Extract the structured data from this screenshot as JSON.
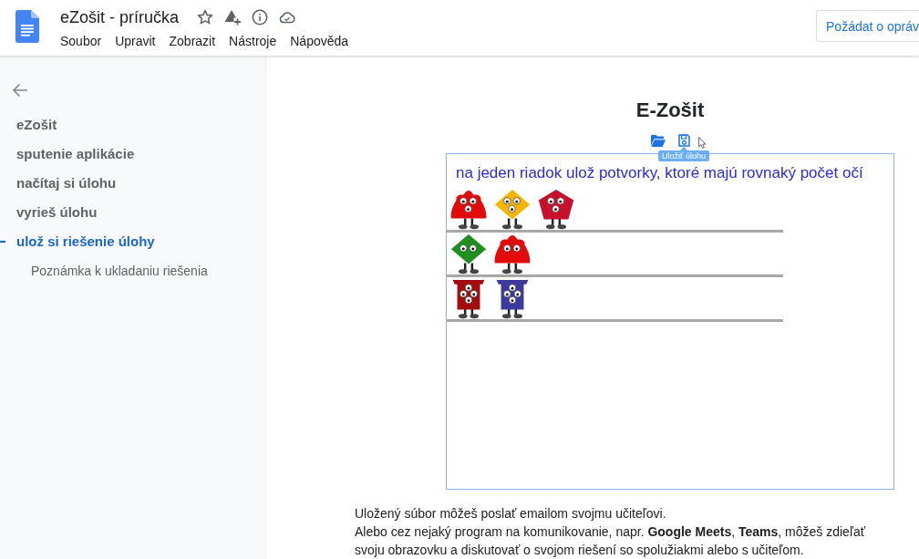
{
  "header": {
    "title": "eZošit - príručka",
    "menu": [
      "Soubor",
      "Upravit",
      "Zobrazit",
      "Nástroje",
      "Nápověda"
    ],
    "button": "Požádat o opráv"
  },
  "sidebar": {
    "items": [
      {
        "label": "eZošit",
        "selected": false
      },
      {
        "label": "sputenie aplikácie",
        "selected": false
      },
      {
        "label": "načítaj si úlohu",
        "selected": false
      },
      {
        "label": "vyrieš úlohu",
        "selected": false
      },
      {
        "label": "ulož si riešenie úlohy",
        "selected": true,
        "children": [
          {
            "label": "Poznámka k ukladaniu riešenia",
            "selected": false
          }
        ]
      }
    ]
  },
  "page": {
    "heading": "E-Zošit",
    "tooltip": "Uložiť úlohu",
    "task": {
      "instruction": "na jeden riadok ulož potvorky, ktoré majú rovnaký počet očí",
      "rows": [
        {
          "monsters": [
            {
              "kind": "blob3",
              "color": "#e20a0a"
            },
            {
              "kind": "diamond3",
              "color": "#f7b500"
            },
            {
              "kind": "pentagon3",
              "color": "#c8102e"
            }
          ]
        },
        {
          "monsters": [
            {
              "kind": "diamond2",
              "color": "#1f8f1f"
            },
            {
              "kind": "blob2",
              "color": "#e20a0a"
            }
          ]
        },
        {
          "monsters": [
            {
              "kind": "banner4",
              "color": "#a30d0d"
            },
            {
              "kind": "banner4",
              "color": "#3d3a9e"
            }
          ]
        }
      ]
    },
    "paragraphs": [
      "Uložený súbor môžeš poslať emailom svojmu učiteľovi.",
      "Alebo cez nejaký program na komunikovanie, napr. **Google Meets**, **Teams**, môžeš zdieľať svoju obrazovku a diskutovať o svojom riešení so spolužiakmi alebo s učiteľom."
    ]
  }
}
